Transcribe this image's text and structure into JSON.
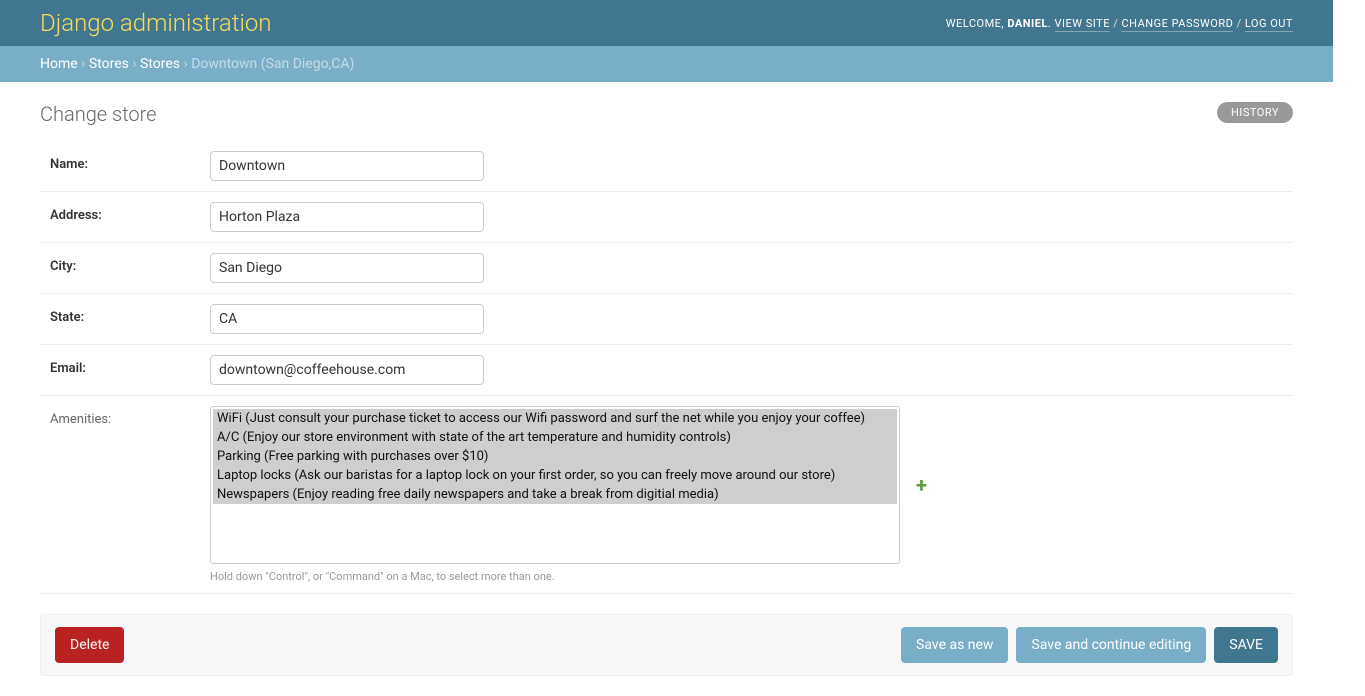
{
  "header": {
    "site_title": "Django administration",
    "welcome": "WELCOME,",
    "username": "DANIEL",
    "view_site": "VIEW SITE",
    "change_password": "CHANGE PASSWORD",
    "log_out": "LOG OUT"
  },
  "breadcrumbs": {
    "home": "Home",
    "app": "Stores",
    "model": "Stores",
    "object": "Downtown (San Diego,CA)"
  },
  "page": {
    "title": "Change store",
    "history": "HISTORY"
  },
  "form": {
    "name": {
      "label": "Name:",
      "value": "Downtown"
    },
    "address": {
      "label": "Address:",
      "value": "Horton Plaza"
    },
    "city": {
      "label": "City:",
      "value": "San Diego"
    },
    "state": {
      "label": "State:",
      "value": "CA"
    },
    "email": {
      "label": "Email:",
      "value": "downtown@coffeehouse.com"
    },
    "amenities": {
      "label": "Amenities:",
      "options": [
        "WiFi (Just consult your purchase ticket to access our Wifi password and surf the net while you enjoy your coffee)",
        "A/C (Enjoy our store environment with state of the art temperature and humidity controls)",
        "Parking (Free parking with purchases over $10)",
        "Laptop locks (Ask our baristas for a laptop lock on your first order, so you can freely move around our store)",
        "Newspapers (Enjoy reading free daily newspapers and take a break from digitial media)"
      ],
      "help": "Hold down \"Control\", or \"Command\" on a Mac, to select more than one."
    }
  },
  "actions": {
    "delete": "Delete",
    "save_as_new": "Save as new",
    "save_continue": "Save and continue editing",
    "save": "SAVE"
  }
}
